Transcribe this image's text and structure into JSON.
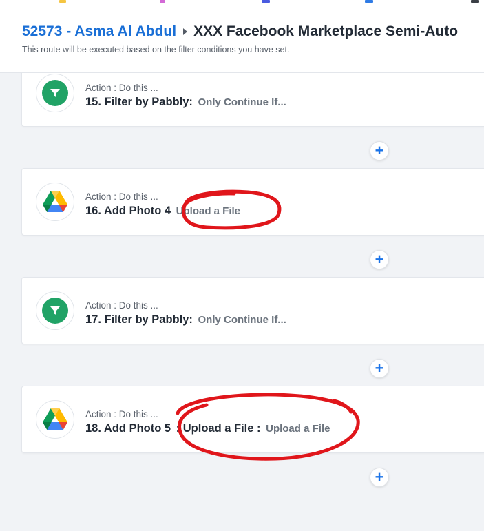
{
  "header": {
    "breadcrumb_link": "52573 - Asma Al Abdul",
    "breadcrumb_current": "XXX Facebook Marketplace Semi-Auto",
    "subtitle": "This route will be executed based on the filter conditions you have set."
  },
  "steps": [
    {
      "label": "Action : Do this ...",
      "title": "15. Filter by Pabbly:",
      "detail": "Only Continue If...",
      "icon": "filter-icon"
    },
    {
      "label": "Action : Do this ...",
      "title": "16. Add Photo 4",
      "detail": "Upload a File",
      "icon": "google-drive-icon"
    },
    {
      "label": "Action : Do this ...",
      "title": "17. Filter by Pabbly:",
      "detail": "Only Continue If...",
      "icon": "filter-icon"
    },
    {
      "label": "Action : Do this ...",
      "title": "18. Add Photo 5",
      "title_mid": ": Upload a File :",
      "detail": "Upload a File",
      "icon": "google-drive-icon"
    }
  ],
  "add_step_symbol": "+",
  "colors": {
    "link": "#1a6fd6",
    "plus": "#1a73e8",
    "filter": "#21a366",
    "annotation": "#e0161b"
  }
}
